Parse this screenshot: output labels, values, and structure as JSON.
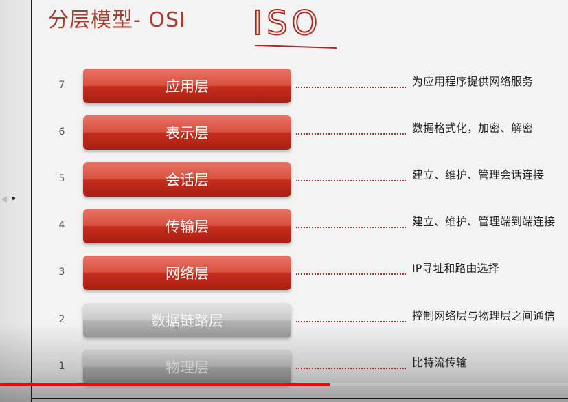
{
  "slide": {
    "title": "分层模型- OSI",
    "annotation": "ISO",
    "layers": [
      {
        "num": "7",
        "name": "应用层",
        "desc": "为应用程序提供网络服务",
        "style": "red"
      },
      {
        "num": "6",
        "name": "表示层",
        "desc": "数据格式化，加密、解密",
        "style": "red"
      },
      {
        "num": "5",
        "name": "会话层",
        "desc": "建立、维护、管理会话连接",
        "style": "red"
      },
      {
        "num": "4",
        "name": "传输层",
        "desc": "建立、维护、管理端到端连接",
        "style": "red"
      },
      {
        "num": "3",
        "name": "网络层",
        "desc": "IP寻址和路由选择",
        "style": "red"
      },
      {
        "num": "2",
        "name": "数据链路层",
        "desc": "控制网络层与物理层之间通信",
        "style": "gray"
      },
      {
        "num": "1",
        "name": "物理层",
        "desc": "比特流传输",
        "style": "gray"
      }
    ]
  },
  "player": {
    "progress": 0.58,
    "progress_color": "#ff0000"
  },
  "colors": {
    "title": "#b23b2d",
    "bar_red": "#c62c1c",
    "bar_gray": "#b3b3b3",
    "dots": "#a83428"
  }
}
